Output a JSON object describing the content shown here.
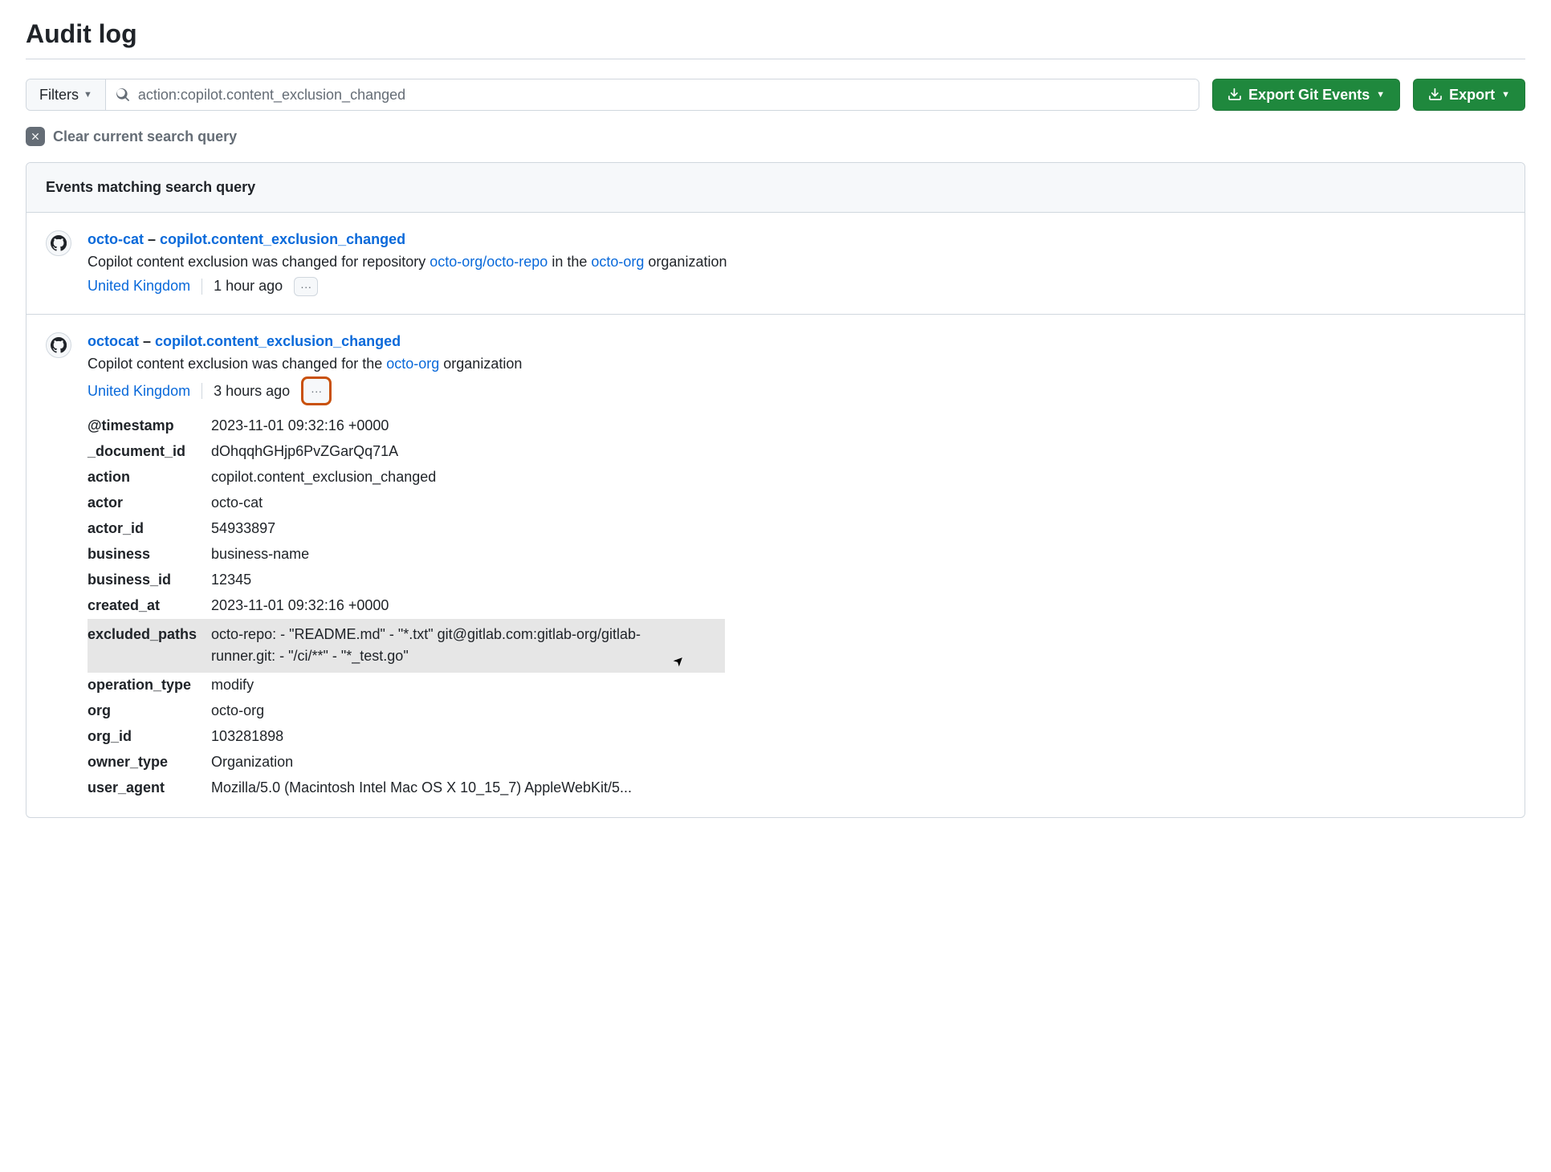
{
  "page": {
    "title": "Audit log"
  },
  "toolbar": {
    "filters_label": "Filters",
    "search_value": "action:copilot.content_exclusion_changed",
    "export_git_label": "Export Git Events",
    "export_label": "Export"
  },
  "clear": {
    "label": "Clear current search query"
  },
  "events_header": "Events matching search query",
  "events": [
    {
      "actor": "octo-cat",
      "action": "copilot.content_exclusion_changed",
      "desc_prefix": "Copilot content exclusion was changed for repository ",
      "repo_link": "octo-org/octo-repo",
      "desc_mid": " in the ",
      "org_link": "octo-org",
      "desc_suffix": " organization",
      "location": "United Kingdom",
      "time_ago": "1 hour ago"
    },
    {
      "actor": "octocat",
      "action": "copilot.content_exclusion_changed",
      "desc_prefix": "Copilot content exclusion was changed for the ",
      "org_link": "octo-org",
      "desc_suffix": " organization",
      "location": "United Kingdom",
      "time_ago": "3 hours ago",
      "details": [
        {
          "k": "@timestamp",
          "v": "2023-11-01 09:32:16 +0000"
        },
        {
          "k": "_document_id",
          "v": "dOhqqhGHjp6PvZGarQq71A"
        },
        {
          "k": "action",
          "v": "copilot.content_exclusion_changed"
        },
        {
          "k": "actor",
          "v": "octo-cat"
        },
        {
          "k": "actor_id",
          "v": "54933897"
        },
        {
          "k": "business",
          "v": "business-name"
        },
        {
          "k": "business_id",
          "v": "12345"
        },
        {
          "k": "created_at",
          "v": "2023-11-01 09:32:16 +0000"
        },
        {
          "k": "excluded_paths",
          "v": "octo-repo: - \"README.md\" - \"*.txt\" git@gitlab.com:gitlab-org/gitlab-runner.git: - \"/ci/**\" - \"*_test.go\"",
          "highlight": true
        },
        {
          "k": "operation_type",
          "v": "modify"
        },
        {
          "k": "org",
          "v": "octo-org"
        },
        {
          "k": "org_id",
          "v": "103281898"
        },
        {
          "k": "owner_type",
          "v": "Organization"
        },
        {
          "k": "user_agent",
          "v": "Mozilla/5.0 (Macintosh Intel Mac OS X 10_15_7) AppleWebKit/5..."
        }
      ]
    }
  ]
}
